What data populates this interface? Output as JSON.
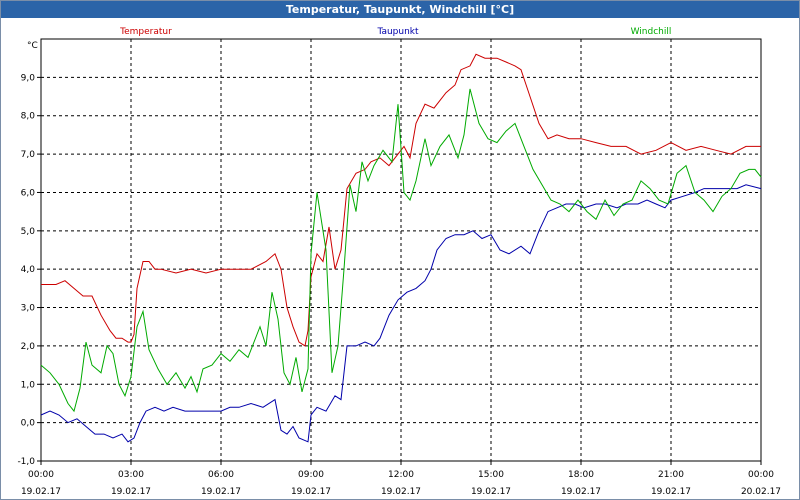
{
  "window": {
    "title": "Temperatur, Taupunkt, Windchill [°C]"
  },
  "chart_data": {
    "type": "line",
    "title": "Temperatur, Taupunkt, Windchill [°C]",
    "ylabel": "°C",
    "ylim": [
      -1.0,
      10.0
    ],
    "yticks": [
      "-1,0",
      "0,0",
      "1,0",
      "2,0",
      "3,0",
      "4,0",
      "5,0",
      "6,0",
      "7,0",
      "8,0",
      "9,0"
    ],
    "xlim": [
      0,
      24
    ],
    "xticks": [
      {
        "time": "00:00",
        "date": "19.02.17"
      },
      {
        "time": "03:00",
        "date": "19.02.17"
      },
      {
        "time": "06:00",
        "date": "19.02.17"
      },
      {
        "time": "09:00",
        "date": "19.02.17"
      },
      {
        "time": "12:00",
        "date": "19.02.17"
      },
      {
        "time": "15:00",
        "date": "19.02.17"
      },
      {
        "time": "18:00",
        "date": "19.02.17"
      },
      {
        "time": "21:00",
        "date": "19.02.17"
      },
      {
        "time": "00:00",
        "date": "20.02.17"
      }
    ],
    "grid": true,
    "legend": "top",
    "series": [
      {
        "name": "Temperatur",
        "color": "#cc0000",
        "points": [
          [
            0.0,
            3.6
          ],
          [
            0.5,
            3.6
          ],
          [
            0.8,
            3.7
          ],
          [
            1.1,
            3.5
          ],
          [
            1.4,
            3.3
          ],
          [
            1.7,
            3.3
          ],
          [
            2.0,
            2.8
          ],
          [
            2.3,
            2.4
          ],
          [
            2.5,
            2.2
          ],
          [
            2.7,
            2.2
          ],
          [
            2.9,
            2.1
          ],
          [
            3.0,
            2.1
          ],
          [
            3.1,
            2.3
          ],
          [
            3.2,
            3.5
          ],
          [
            3.4,
            4.2
          ],
          [
            3.6,
            4.2
          ],
          [
            3.8,
            4.0
          ],
          [
            4.0,
            4.0
          ],
          [
            4.5,
            3.9
          ],
          [
            5.0,
            4.0
          ],
          [
            5.5,
            3.9
          ],
          [
            6.0,
            4.0
          ],
          [
            6.5,
            4.0
          ],
          [
            7.0,
            4.0
          ],
          [
            7.5,
            4.2
          ],
          [
            7.8,
            4.4
          ],
          [
            8.0,
            4.0
          ],
          [
            8.2,
            3.0
          ],
          [
            8.4,
            2.5
          ],
          [
            8.6,
            2.1
          ],
          [
            8.8,
            2.0
          ],
          [
            8.9,
            2.4
          ],
          [
            9.0,
            3.8
          ],
          [
            9.2,
            4.4
          ],
          [
            9.4,
            4.2
          ],
          [
            9.6,
            5.1
          ],
          [
            9.8,
            4.0
          ],
          [
            10.0,
            4.5
          ],
          [
            10.2,
            6.1
          ],
          [
            10.5,
            6.5
          ],
          [
            10.8,
            6.6
          ],
          [
            11.0,
            6.8
          ],
          [
            11.3,
            6.9
          ],
          [
            11.6,
            6.7
          ],
          [
            11.9,
            7.0
          ],
          [
            12.1,
            7.2
          ],
          [
            12.3,
            6.9
          ],
          [
            12.5,
            7.8
          ],
          [
            12.8,
            8.3
          ],
          [
            13.1,
            8.2
          ],
          [
            13.5,
            8.6
          ],
          [
            13.8,
            8.8
          ],
          [
            14.0,
            9.2
          ],
          [
            14.3,
            9.3
          ],
          [
            14.5,
            9.6
          ],
          [
            14.8,
            9.5
          ],
          [
            15.2,
            9.5
          ],
          [
            15.5,
            9.4
          ],
          [
            15.8,
            9.3
          ],
          [
            16.0,
            9.2
          ],
          [
            16.3,
            8.5
          ],
          [
            16.6,
            7.8
          ],
          [
            16.9,
            7.4
          ],
          [
            17.2,
            7.5
          ],
          [
            17.6,
            7.4
          ],
          [
            18.0,
            7.4
          ],
          [
            18.5,
            7.3
          ],
          [
            19.0,
            7.2
          ],
          [
            19.5,
            7.2
          ],
          [
            20.0,
            7.0
          ],
          [
            20.5,
            7.1
          ],
          [
            21.0,
            7.3
          ],
          [
            21.5,
            7.1
          ],
          [
            22.0,
            7.2
          ],
          [
            22.5,
            7.1
          ],
          [
            23.0,
            7.0
          ],
          [
            23.5,
            7.2
          ],
          [
            24.0,
            7.2
          ]
        ]
      },
      {
        "name": "Taupunkt",
        "color": "#0000aa",
        "points": [
          [
            0.0,
            0.2
          ],
          [
            0.3,
            0.3
          ],
          [
            0.6,
            0.2
          ],
          [
            0.9,
            0.0
          ],
          [
            1.2,
            0.1
          ],
          [
            1.5,
            -0.1
          ],
          [
            1.8,
            -0.3
          ],
          [
            2.1,
            -0.3
          ],
          [
            2.4,
            -0.4
          ],
          [
            2.7,
            -0.3
          ],
          [
            2.9,
            -0.5
          ],
          [
            3.1,
            -0.4
          ],
          [
            3.3,
            0.0
          ],
          [
            3.5,
            0.3
          ],
          [
            3.8,
            0.4
          ],
          [
            4.1,
            0.3
          ],
          [
            4.4,
            0.4
          ],
          [
            4.8,
            0.3
          ],
          [
            5.2,
            0.3
          ],
          [
            5.6,
            0.3
          ],
          [
            6.0,
            0.3
          ],
          [
            6.3,
            0.4
          ],
          [
            6.6,
            0.4
          ],
          [
            7.0,
            0.5
          ],
          [
            7.4,
            0.4
          ],
          [
            7.8,
            0.6
          ],
          [
            8.0,
            -0.2
          ],
          [
            8.2,
            -0.3
          ],
          [
            8.4,
            -0.1
          ],
          [
            8.6,
            -0.4
          ],
          [
            8.9,
            -0.5
          ],
          [
            9.0,
            0.2
          ],
          [
            9.2,
            0.4
          ],
          [
            9.5,
            0.3
          ],
          [
            9.8,
            0.7
          ],
          [
            10.0,
            0.6
          ],
          [
            10.2,
            2.0
          ],
          [
            10.5,
            2.0
          ],
          [
            10.8,
            2.1
          ],
          [
            11.1,
            2.0
          ],
          [
            11.3,
            2.2
          ],
          [
            11.6,
            2.8
          ],
          [
            11.9,
            3.2
          ],
          [
            12.2,
            3.4
          ],
          [
            12.5,
            3.5
          ],
          [
            12.8,
            3.7
          ],
          [
            13.0,
            4.0
          ],
          [
            13.2,
            4.5
          ],
          [
            13.5,
            4.8
          ],
          [
            13.8,
            4.9
          ],
          [
            14.1,
            4.9
          ],
          [
            14.4,
            5.0
          ],
          [
            14.7,
            4.8
          ],
          [
            15.0,
            4.9
          ],
          [
            15.3,
            4.5
          ],
          [
            15.6,
            4.4
          ],
          [
            16.0,
            4.6
          ],
          [
            16.3,
            4.4
          ],
          [
            16.6,
            5.0
          ],
          [
            16.9,
            5.5
          ],
          [
            17.2,
            5.6
          ],
          [
            17.5,
            5.7
          ],
          [
            17.8,
            5.7
          ],
          [
            18.1,
            5.6
          ],
          [
            18.5,
            5.7
          ],
          [
            18.8,
            5.7
          ],
          [
            19.2,
            5.6
          ],
          [
            19.5,
            5.7
          ],
          [
            19.9,
            5.7
          ],
          [
            20.2,
            5.8
          ],
          [
            20.5,
            5.7
          ],
          [
            20.8,
            5.6
          ],
          [
            21.0,
            5.8
          ],
          [
            21.4,
            5.9
          ],
          [
            21.8,
            6.0
          ],
          [
            22.1,
            6.1
          ],
          [
            22.5,
            6.1
          ],
          [
            22.9,
            6.1
          ],
          [
            23.2,
            6.1
          ],
          [
            23.5,
            6.2
          ],
          [
            24.0,
            6.1
          ]
        ]
      },
      {
        "name": "Windchill",
        "color": "#00aa00",
        "points": [
          [
            0.0,
            1.5
          ],
          [
            0.3,
            1.3
          ],
          [
            0.6,
            1.0
          ],
          [
            0.9,
            0.5
          ],
          [
            1.1,
            0.3
          ],
          [
            1.3,
            0.9
          ],
          [
            1.5,
            2.1
          ],
          [
            1.7,
            1.5
          ],
          [
            2.0,
            1.3
          ],
          [
            2.2,
            2.0
          ],
          [
            2.4,
            1.8
          ],
          [
            2.6,
            1.0
          ],
          [
            2.8,
            0.7
          ],
          [
            3.0,
            1.2
          ],
          [
            3.2,
            2.5
          ],
          [
            3.4,
            2.9
          ],
          [
            3.6,
            1.9
          ],
          [
            3.9,
            1.4
          ],
          [
            4.2,
            1.0
          ],
          [
            4.5,
            1.3
          ],
          [
            4.8,
            0.9
          ],
          [
            5.0,
            1.2
          ],
          [
            5.2,
            0.8
          ],
          [
            5.4,
            1.4
          ],
          [
            5.7,
            1.5
          ],
          [
            6.0,
            1.8
          ],
          [
            6.3,
            1.6
          ],
          [
            6.6,
            1.9
          ],
          [
            6.9,
            1.7
          ],
          [
            7.1,
            2.1
          ],
          [
            7.3,
            2.5
          ],
          [
            7.5,
            2.0
          ],
          [
            7.7,
            3.4
          ],
          [
            7.9,
            2.7
          ],
          [
            8.1,
            1.3
          ],
          [
            8.3,
            1.0
          ],
          [
            8.5,
            1.7
          ],
          [
            8.7,
            0.8
          ],
          [
            8.9,
            1.4
          ],
          [
            9.0,
            4.4
          ],
          [
            9.2,
            6.0
          ],
          [
            9.5,
            4.5
          ],
          [
            9.7,
            1.3
          ],
          [
            9.9,
            2.0
          ],
          [
            10.1,
            4.0
          ],
          [
            10.3,
            6.2
          ],
          [
            10.5,
            5.5
          ],
          [
            10.7,
            6.8
          ],
          [
            10.9,
            6.3
          ],
          [
            11.1,
            6.7
          ],
          [
            11.4,
            7.1
          ],
          [
            11.7,
            6.8
          ],
          [
            11.9,
            8.3
          ],
          [
            12.1,
            6.0
          ],
          [
            12.3,
            5.8
          ],
          [
            12.5,
            6.3
          ],
          [
            12.8,
            7.4
          ],
          [
            13.0,
            6.7
          ],
          [
            13.3,
            7.2
          ],
          [
            13.6,
            7.5
          ],
          [
            13.9,
            6.9
          ],
          [
            14.1,
            7.5
          ],
          [
            14.3,
            8.7
          ],
          [
            14.6,
            7.8
          ],
          [
            14.9,
            7.4
          ],
          [
            15.2,
            7.3
          ],
          [
            15.5,
            7.6
          ],
          [
            15.8,
            7.8
          ],
          [
            16.1,
            7.2
          ],
          [
            16.4,
            6.6
          ],
          [
            16.7,
            6.2
          ],
          [
            17.0,
            5.8
          ],
          [
            17.3,
            5.7
          ],
          [
            17.6,
            5.5
          ],
          [
            17.9,
            5.8
          ],
          [
            18.2,
            5.5
          ],
          [
            18.5,
            5.3
          ],
          [
            18.8,
            5.8
          ],
          [
            19.1,
            5.4
          ],
          [
            19.4,
            5.7
          ],
          [
            19.7,
            5.8
          ],
          [
            20.0,
            6.3
          ],
          [
            20.3,
            6.1
          ],
          [
            20.6,
            5.8
          ],
          [
            20.9,
            5.7
          ],
          [
            21.2,
            6.5
          ],
          [
            21.5,
            6.7
          ],
          [
            21.8,
            6.0
          ],
          [
            22.1,
            5.8
          ],
          [
            22.4,
            5.5
          ],
          [
            22.7,
            5.9
          ],
          [
            23.0,
            6.1
          ],
          [
            23.3,
            6.5
          ],
          [
            23.6,
            6.6
          ],
          [
            23.8,
            6.6
          ],
          [
            24.0,
            6.4
          ]
        ]
      }
    ]
  }
}
